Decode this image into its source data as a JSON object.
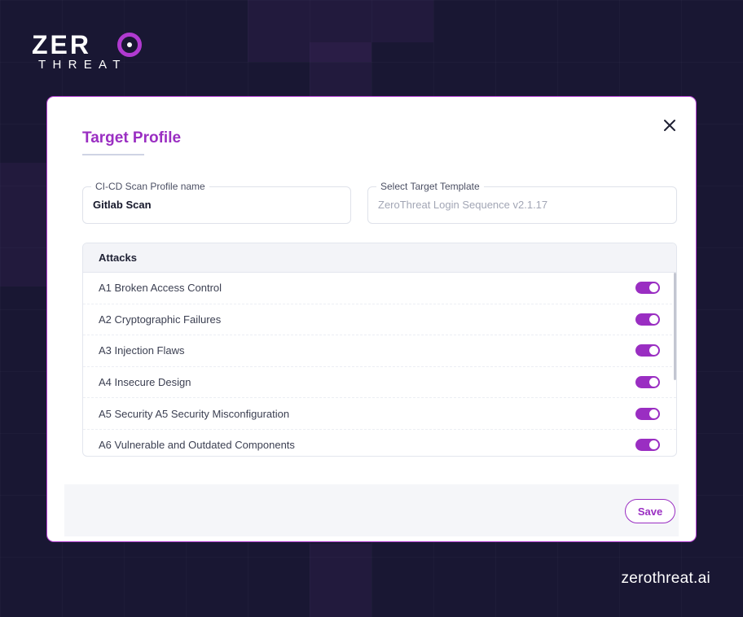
{
  "brand": {
    "logo_word_top": "ZER",
    "logo_word_bottom": "THREAT",
    "site_url": "zerothreat.ai",
    "accent_color": "#9a2ec2"
  },
  "modal": {
    "title": "Target Profile",
    "close_icon": "close-icon",
    "fields": {
      "profile_name": {
        "label": "CI-CD Scan Profile name",
        "value": "Gitlab Scan"
      },
      "target_template": {
        "label": "Select Target Template",
        "value": "ZeroThreat Login Sequence v2.1.17"
      }
    },
    "attacks": {
      "header": "Attacks",
      "items": [
        {
          "label": "A1 Broken Access Control",
          "enabled": true
        },
        {
          "label": "A2 Cryptographic Failures",
          "enabled": true
        },
        {
          "label": "A3 Injection Flaws",
          "enabled": true
        },
        {
          "label": "A4 Insecure Design",
          "enabled": true
        },
        {
          "label": "A5 Security A5 Security Misconfiguration",
          "enabled": true
        },
        {
          "label": "A6 Vulnerable and Outdated Components",
          "enabled": true
        }
      ]
    },
    "save_label": "Save"
  }
}
